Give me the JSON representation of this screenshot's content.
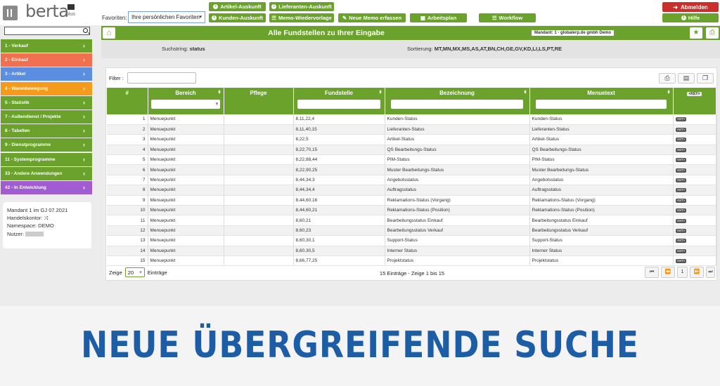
{
  "header": {
    "logo_text": "berta",
    "logo_suffix": "plus",
    "favorites_label": "Favoriten:",
    "favorites_value": "Ihre persönlichen Favoriten",
    "buttons": {
      "artikel": "Artikel-Auskunft",
      "lieferanten": "Lieferanten-Auskunft",
      "kunden": "Kunden-Auskunft",
      "memo_wieder": "Memo-Wiedervorlage",
      "memo_neu": "Neue Memo erfassen",
      "arbeitsplan": "Arbeitsplan",
      "workflow": "Workflow",
      "abmelden": "Abmelden",
      "hilfe": "Hilfe"
    },
    "colors": {
      "green": "#6aa22c",
      "red": "#c9302c"
    }
  },
  "sidebar": {
    "items": [
      {
        "label": "1 - Verkauf",
        "color": "#6aa22c"
      },
      {
        "label": "2 - Einkauf",
        "color": "#f0704f"
      },
      {
        "label": "3 - Artikel",
        "color": "#5b8ee0"
      },
      {
        "label": "4 - Warenbewegung",
        "color": "#f59b1c"
      },
      {
        "label": "5 - Statistik",
        "color": "#6aa22c"
      },
      {
        "label": "7 - Außendienst / Projekte",
        "color": "#6aa22c"
      },
      {
        "label": "8 - Tabellen",
        "color": "#6aa22c"
      },
      {
        "label": "9 - Dienstprogramme",
        "color": "#6aa22c"
      },
      {
        "label": "11 - Systemprogramme",
        "color": "#6aa22c"
      },
      {
        "label": "33 - Andere Anwendungen",
        "color": "#6aa22c"
      },
      {
        "label": "42 - In Entwicklung",
        "color": "#a05cd0"
      }
    ],
    "info": {
      "mandant": "Mandant 1 im GJ 07.2021",
      "handelskontor": "Handelskontor:",
      "namespace": "Namespace: DEMO",
      "nutzer": "Nutzer:"
    }
  },
  "main": {
    "title": "Alle Fundstellen zu Ihrer Eingabe",
    "mandant_badge": "Mandant: 1 - globalerp.de gmbh Demo",
    "suchstring_label": "Suchstring:",
    "suchstring_value": "status",
    "sortierung_label": "Sortierung:",
    "sortierung_value": "MT,MN,MX,MS,AS,AT,BN,CH,GE,GV,KD,LI,LS,PT,RE",
    "filter_label": "Filter :",
    "columns": [
      "#",
      "Bereich",
      "Pflege",
      "Fundstelle",
      "Bezeichnung",
      "Menuetext",
      "<KEY>"
    ],
    "rows": [
      {
        "num": "1",
        "bereich": "Menuepunkt",
        "fund": "8,11,22,4",
        "bez": "Kunden-Status",
        "menu": "Kunden-Status",
        "key": "<MT>"
      },
      {
        "num": "2",
        "bereich": "Menuepunkt",
        "fund": "8,11,40,15",
        "bez": "Lieferanten-Status",
        "menu": "Lieferanten-Status",
        "key": "<MT>"
      },
      {
        "num": "3",
        "bereich": "Menuepunkt",
        "fund": "8,22,5",
        "bez": "Artikel-Status",
        "menu": "Artikel-Status",
        "key": "<MT>"
      },
      {
        "num": "4",
        "bereich": "Menuepunkt",
        "fund": "8,22,70,15",
        "bez": "QS Bearbeitungs-Status",
        "menu": "QS Bearbeitungs-Status",
        "key": "<MT>"
      },
      {
        "num": "5",
        "bereich": "Menuepunkt",
        "fund": "8,22,88,44",
        "bez": "PIM-Status",
        "menu": "PIM-Status",
        "key": "<MT>"
      },
      {
        "num": "6",
        "bereich": "Menuepunkt",
        "fund": "8,22,90,25",
        "bez": "Muster Bearbeitungs-Status",
        "menu": "Muster Bearbeitungs-Status",
        "key": "<MT>"
      },
      {
        "num": "7",
        "bereich": "Menuepunkt",
        "fund": "8,44,34,3",
        "bez": "Angebotsstatus",
        "menu": "Angebotsstatus",
        "key": "<MT>"
      },
      {
        "num": "8",
        "bereich": "Menuepunkt",
        "fund": "8,44,34,4",
        "bez": "Auftragsstatus",
        "menu": "Auftragsstatus",
        "key": "<MT>"
      },
      {
        "num": "9",
        "bereich": "Menuepunkt",
        "fund": "8,44,60,16",
        "bez": "Reklamations-Status (Vorgang)",
        "menu": "Reklamations-Status (Vorgang)",
        "key": "<MT>"
      },
      {
        "num": "10",
        "bereich": "Menuepunkt",
        "fund": "8,44,60,21",
        "bez": "Reklamations-Status (Position)",
        "menu": "Reklamations-Status (Position)",
        "key": "<MT>"
      },
      {
        "num": "11",
        "bereich": "Menuepunkt",
        "fund": "8,60,21",
        "bez": "Bearbeitungsstatus Einkauf",
        "menu": "Bearbeitungsstatus Einkauf",
        "key": "<MT>"
      },
      {
        "num": "12",
        "bereich": "Menuepunkt",
        "fund": "8,60,23",
        "bez": "Bearbeitungsstatus Verkauf",
        "menu": "Bearbeitungsstatus Verkauf",
        "key": "<MT>"
      },
      {
        "num": "13",
        "bereich": "Menuepunkt",
        "fund": "8,60,30,1",
        "bez": "Support-Status",
        "menu": "Support-Status",
        "key": "<MT>"
      },
      {
        "num": "14",
        "bereich": "Menuepunkt",
        "fund": "8,60,30,5",
        "bez": "Interner Status",
        "menu": "Interner Status",
        "key": "<MT>"
      },
      {
        "num": "15",
        "bereich": "Menuepunkt",
        "fund": "8,66,77,25",
        "bez": "Projektstatus",
        "menu": "Projektstatus",
        "key": "<MT>"
      }
    ],
    "pager": {
      "zeige": "Zeige",
      "page_size": "20",
      "eintraege": "Einträge",
      "info": "15 Einträge - Zeige 1 bis 15",
      "current_page": "1"
    }
  },
  "banner": {
    "text": "NEUE ÜBERGREIFENDE SUCHE",
    "color": "#1c5da6"
  }
}
